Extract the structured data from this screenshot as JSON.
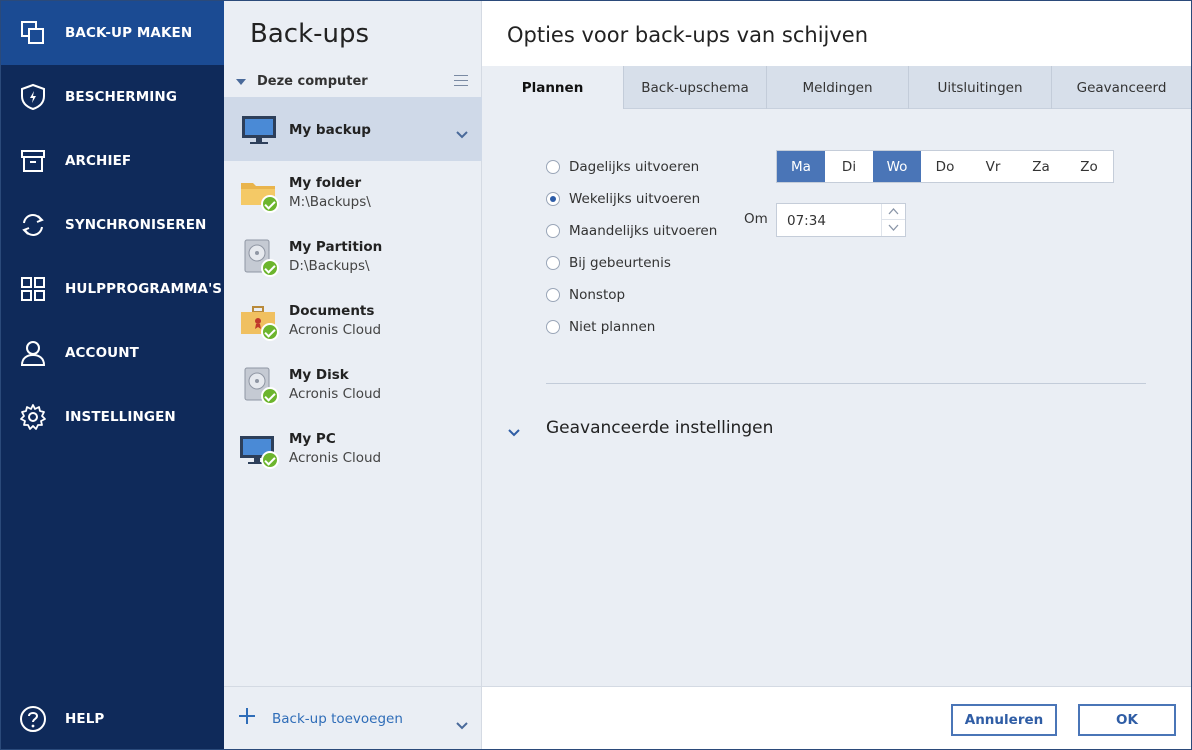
{
  "nav": {
    "items": [
      {
        "label": "BACK-UP MAKEN",
        "icon": "copy-icon"
      },
      {
        "label": "BESCHERMING",
        "icon": "shield-icon"
      },
      {
        "label": "ARCHIEF",
        "icon": "archive-icon"
      },
      {
        "label": "SYNCHRONISEREN",
        "icon": "sync-icon"
      },
      {
        "label": "HULPPROGRAMMA'S",
        "icon": "grid-icon"
      },
      {
        "label": "ACCOUNT",
        "icon": "user-icon"
      },
      {
        "label": "INSTELLINGEN",
        "icon": "gear-icon"
      }
    ],
    "help": "HELP",
    "active_color": "#1b4b93",
    "bg_color": "#0f2a5a"
  },
  "list": {
    "title": "Back-ups",
    "group": "Deze computer",
    "items": [
      {
        "name": "My backup",
        "sub": "",
        "icon": "monitor-icon"
      },
      {
        "name": "My folder",
        "sub": "M:\\Backups\\",
        "icon": "folder-icon"
      },
      {
        "name": "My Partition",
        "sub": "D:\\Backups\\",
        "icon": "hard-drive-icon"
      },
      {
        "name": "Documents",
        "sub": "Acronis Cloud",
        "icon": "briefcase-icon"
      },
      {
        "name": "My Disk",
        "sub": "Acronis Cloud",
        "icon": "hard-drive-icon"
      },
      {
        "name": "My PC",
        "sub": "Acronis Cloud",
        "icon": "monitor-icon"
      }
    ],
    "add_label": "Back-up toevoegen"
  },
  "content": {
    "title": "Opties voor back-ups van schijven",
    "tabs": [
      "Plannen",
      "Back-upschema",
      "Meldingen",
      "Uitsluitingen",
      "Geavanceerd"
    ],
    "schedule_options": [
      {
        "label": "Dagelijks uitvoeren",
        "selected": false
      },
      {
        "label": "Wekelijks uitvoeren",
        "selected": true
      },
      {
        "label": "Maandelijks uitvoeren",
        "selected": false
      },
      {
        "label": "Bij gebeurtenis",
        "selected": false
      },
      {
        "label": "Nonstop",
        "selected": false
      },
      {
        "label": "Niet plannen",
        "selected": false
      }
    ],
    "days": [
      {
        "label": "Ma",
        "selected": true
      },
      {
        "label": "Di",
        "selected": false
      },
      {
        "label": "Wo",
        "selected": true
      },
      {
        "label": "Do",
        "selected": false
      },
      {
        "label": "Vr",
        "selected": false
      },
      {
        "label": "Za",
        "selected": false
      },
      {
        "label": "Zo",
        "selected": false
      }
    ],
    "time_label": "Om",
    "time_value": "07:34",
    "advanced_settings": "Geavanceerde instellingen",
    "cancel": "Annuleren",
    "ok": "OK",
    "accent_color": "#4a75b7"
  }
}
